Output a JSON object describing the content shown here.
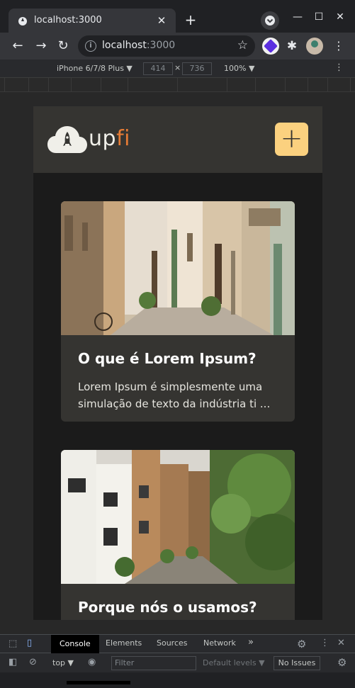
{
  "browser": {
    "tab_title": "localhost:3000",
    "url_host": "localhost",
    "url_port": ":3000",
    "new_tab_glyph": "+",
    "close_glyph": "✕",
    "back_glyph": "←",
    "forward_glyph": "→",
    "reload_glyph": "↻",
    "star_glyph": "☆",
    "minimize_glyph": "—",
    "maximize_glyph": "☐",
    "window_close_glyph": "✕"
  },
  "device_toolbar": {
    "device": "iPhone 6/7/8 Plus ▼",
    "width": "414",
    "height": "736",
    "separator": "×",
    "zoom": "100% ▼"
  },
  "app": {
    "logo_text_main": "up",
    "logo_text_accent": "fi",
    "add_button_glyph": "+",
    "cards": [
      {
        "title": "O que é Lorem Ipsum?",
        "description": "Lorem Ipsum é simplesmente uma simulação de texto da indústria ti ..."
      },
      {
        "title": "Porque nós o usamos?",
        "description": ""
      }
    ]
  },
  "devtools": {
    "tabs": [
      "Console",
      "Elements",
      "Sources",
      "Network"
    ],
    "more_tabs": "»",
    "context": "top ▼",
    "filter_placeholder": "Filter",
    "levels": "Default levels ▼",
    "issues": "No Issues"
  },
  "colors": {
    "accent_yellow": "#fbd17f",
    "accent_orange": "#e57b35",
    "header_bg": "#353431",
    "page_bg": "#1b1b1b"
  }
}
